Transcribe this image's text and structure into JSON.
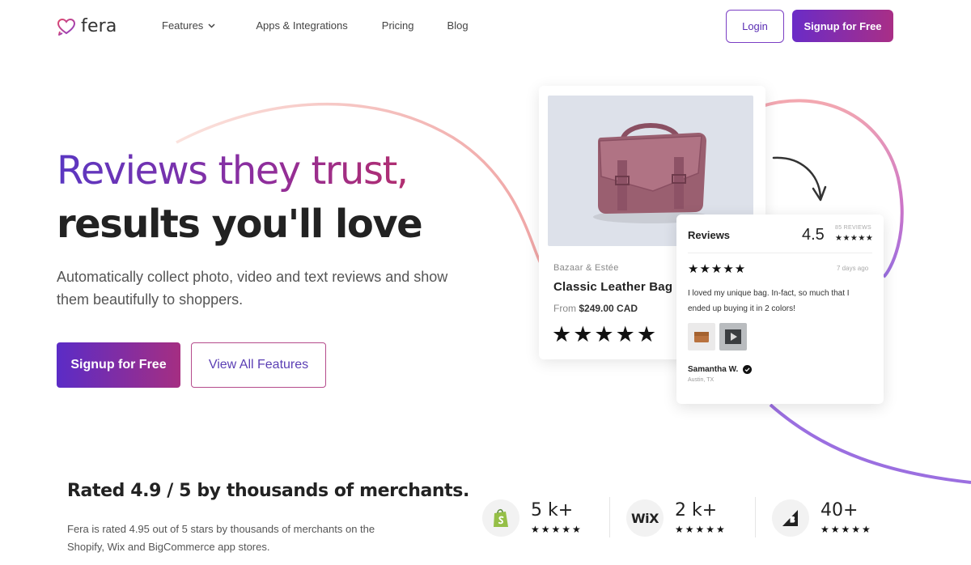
{
  "nav": {
    "logo_text": "fera",
    "links": [
      {
        "label": "Features"
      },
      {
        "label": "Apps & Integrations"
      },
      {
        "label": "Pricing"
      },
      {
        "label": "Blog"
      }
    ],
    "login_label": "Login",
    "signup_label": "Signup for Free"
  },
  "hero": {
    "title_line1": "Reviews they trust,",
    "title_line2": "results you'll love",
    "subtitle": "Automatically collect photo, video and text reviews and show them beautifully to shoppers.",
    "cta_primary": "Signup for Free",
    "cta_secondary": "View All Features"
  },
  "product_card": {
    "brand": "Bazaar & Estée",
    "name": "Classic Leather Bag",
    "price_prefix": "From",
    "price": "$249.00 CAD",
    "stars": "★★★★★"
  },
  "review_card": {
    "title": "Reviews",
    "rating": "4.5",
    "count": "85 REVIEWS",
    "rating_stars": "★★★★★",
    "review_stars": "★★★★★",
    "time": "7 days ago",
    "text": "I loved my unique bag. In-fact, so much that I ended up buying it in 2 colors!",
    "reviewer_name": "Samantha W.",
    "reviewer_location": "Austin, TX"
  },
  "rating_section": {
    "title": "Rated 4.9 / 5 by thousands of merchants.",
    "description": "Fera is rated 4.95 out of 5 stars by thousands of merchants on the Shopify, Wix and BigCommerce app stores.",
    "stores": [
      {
        "name": "shopify",
        "count": "5 k+",
        "stars": "★★★★★"
      },
      {
        "name": "wix",
        "count": "2 k+",
        "stars": "★★★★★",
        "logo_text": "WiX"
      },
      {
        "name": "bigcommerce",
        "count": "40+",
        "stars": "★★★★★"
      }
    ]
  },
  "colors": {
    "brand_purple": "#6a2cc7",
    "brand_magenta": "#a92e86",
    "curve_pink": "#f1a9a9",
    "curve_purple": "#9b6fe0"
  }
}
